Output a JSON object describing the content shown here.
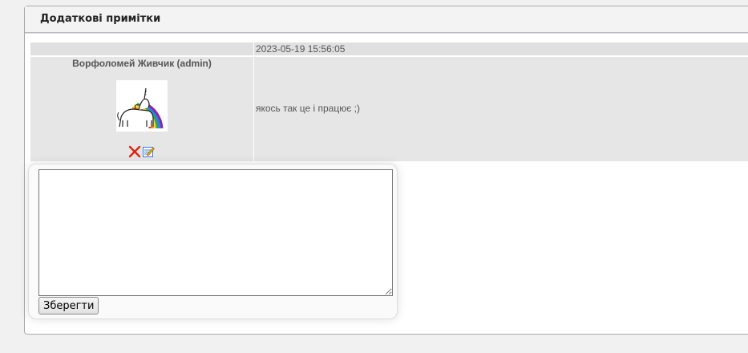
{
  "panel": {
    "title": "Додаткові примітки"
  },
  "note": {
    "date": "2023-05-19 15:56:05",
    "author": "Ворфоломей Живчик (admin)",
    "avatar_icon": "unicorn-rainbow-avatar",
    "message": "якось так це і працює ;)",
    "delete_icon": "red-x-icon",
    "edit_icon": "edit-note-icon"
  },
  "editor": {
    "textarea_value": "",
    "save_label": "Зберегти"
  },
  "colors": {
    "row_bg": "#e6e6e6",
    "date_row_bg": "#e0e0e0",
    "text_gray": "#555555",
    "delete_red": "#e32212"
  }
}
